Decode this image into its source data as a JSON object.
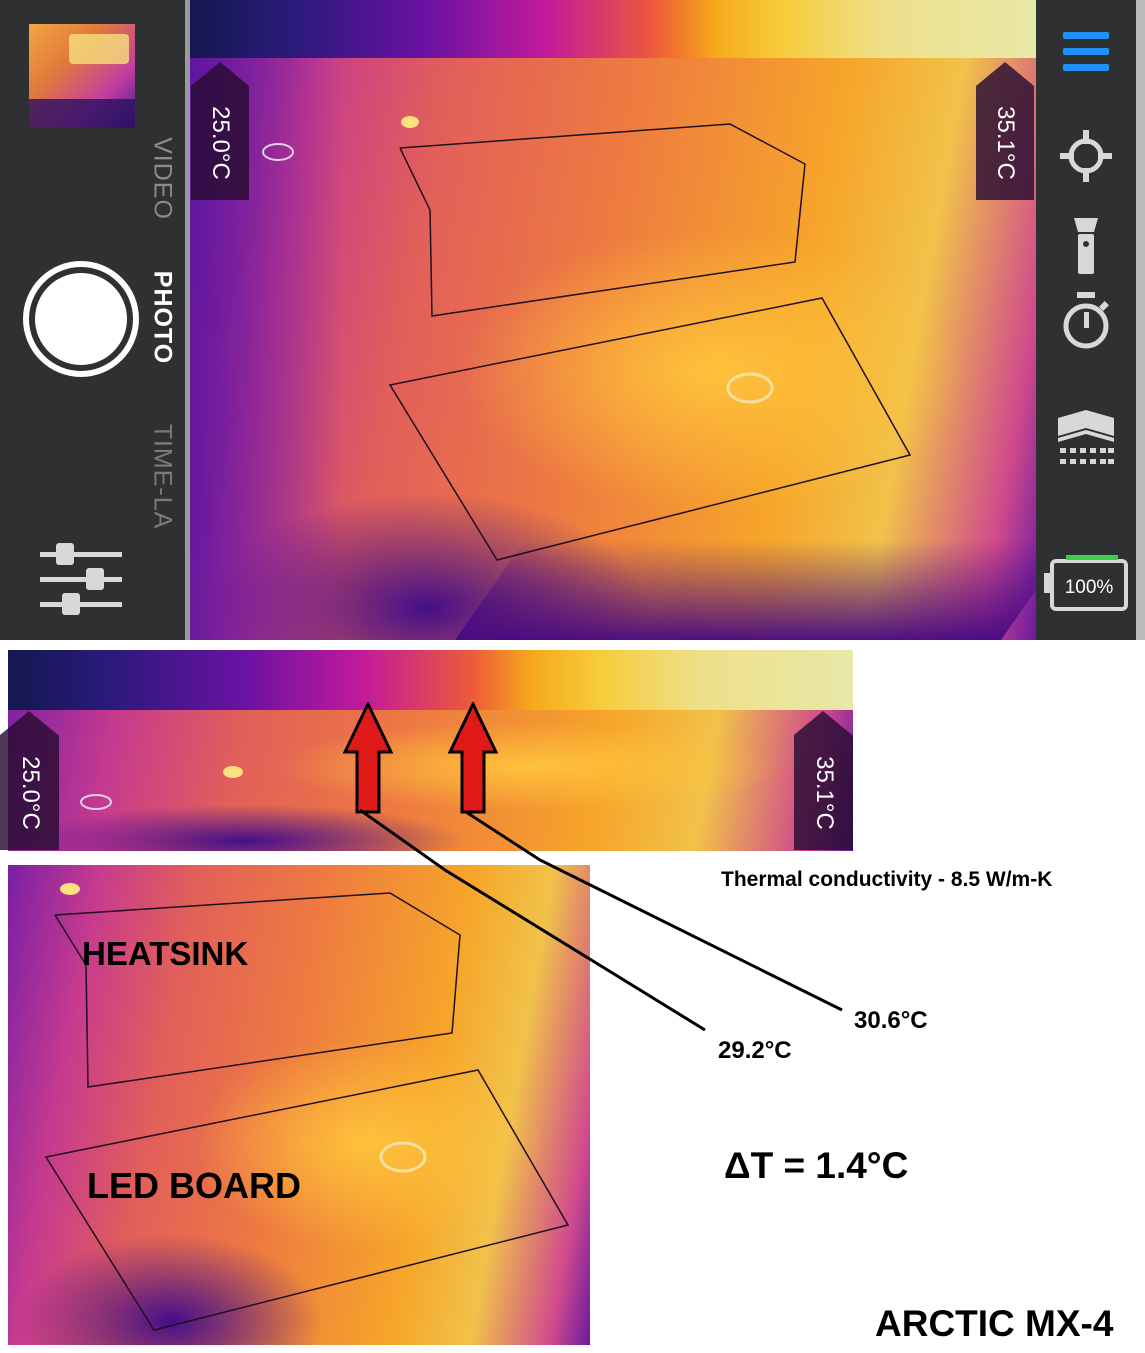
{
  "camera_ui": {
    "modes": {
      "video": "VIDEO",
      "photo": "PHOTO",
      "timelapse": "TIME-LA"
    },
    "scale": {
      "min_temp": "25.0°C",
      "max_temp": "35.1°C"
    },
    "battery": "100%",
    "icons": [
      "sliders-icon",
      "menu-icon",
      "crosshair-icon",
      "flashlight-icon",
      "timer-icon",
      "layers-icon",
      "battery-icon"
    ],
    "accent_color": "#1e90ff",
    "battery_color": "#3ecf4a"
  },
  "annotations": {
    "conductivity": "Thermal conductivity - 8.5 W/m-K",
    "temp_low": "29.2°C",
    "temp_high": "30.6°C",
    "delta": "ΔT = 1.4°C",
    "heatsink": "HEATSINK",
    "led_board": "LED BOARD",
    "product": "ARCTIC MX-4",
    "arrow_color": "#e01919"
  }
}
